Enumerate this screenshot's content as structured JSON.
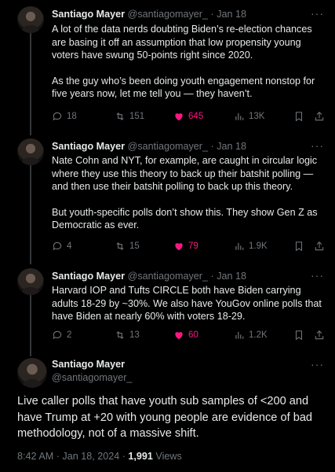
{
  "tweets": [
    {
      "name": "Santiago Mayer",
      "handle": "@santiagomayer_",
      "separator": "·",
      "date": "Jan 18",
      "more": "···",
      "paragraphs": [
        "A lot of the data nerds doubting Biden’s re-election chances are basing it off an assumption that low propensity young voters have swung 50-points right since 2020.",
        "As the guy who’s been doing youth engagement nonstop for five years now, let me tell you — they haven’t."
      ],
      "replies": "18",
      "reposts": "151",
      "likes": "645",
      "views": "13K"
    },
    {
      "name": "Santiago Mayer",
      "handle": "@santiagomayer_",
      "separator": "·",
      "date": "Jan 18",
      "more": "···",
      "paragraphs": [
        "Nate Cohn and NYT, for example, are caught in circular logic where they use this theory to back up their batshit polling — and then use their batshit polling to back up this theory.",
        "But youth-specific polls don’t show this. They show Gen Z as Democratic as ever."
      ],
      "replies": "4",
      "reposts": "15",
      "likes": "79",
      "views": "1.9K"
    },
    {
      "name": "Santiago Mayer",
      "handle": "@santiagomayer_",
      "separator": "·",
      "date": "Jan 18",
      "more": "···",
      "paragraphs": [
        "Harvard IOP and Tufts CIRCLE both have Biden carrying adults 18-29 by ~30%. We also have YouGov online polls that have Biden at nearly 60% with voters 18-29."
      ],
      "replies": "2",
      "reposts": "13",
      "likes": "60",
      "views": "1.2K"
    }
  ],
  "main": {
    "name": "Santiago Mayer",
    "handle": "@santiagomayer_",
    "more": "···",
    "text": "Live caller polls that have youth sub samples of <200 and have Trump at +20 with young people are evidence of bad methodology, not of a massive shift.",
    "timestamp": "8:42 AM · Jan 18, 2024 · ",
    "views_count": "1,991",
    "views_label": " Views"
  },
  "colors": {
    "background": "#000000",
    "text": "#e7e9ea",
    "muted": "#71767b",
    "like": "#f91880",
    "thread": "#333639"
  },
  "icons": [
    "reply-icon",
    "repost-icon",
    "heart-icon",
    "views-icon",
    "bookmark-icon",
    "share-icon",
    "more-icon"
  ]
}
